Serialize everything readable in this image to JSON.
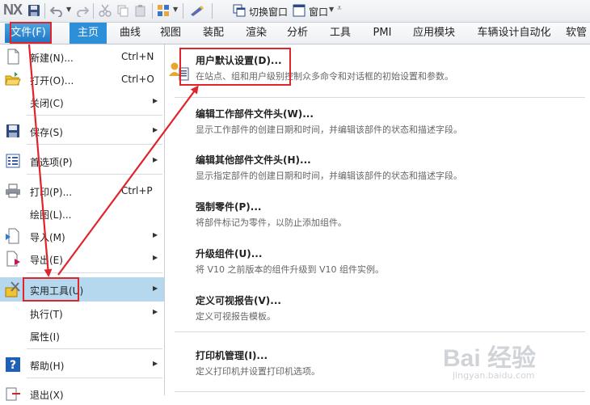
{
  "quick_access": {
    "logo": "NX",
    "switch_window": "切换窗口",
    "window": "窗口"
  },
  "ribbon": {
    "file_tab": "文件(F)",
    "tabs": [
      "主页",
      "曲线",
      "视图",
      "装配",
      "渲染",
      "分析",
      "工具",
      "PMI",
      "应用模块",
      "车辆设计自动化",
      "软管"
    ]
  },
  "file_menu": {
    "items": [
      {
        "label": "新建(N)...",
        "shortcut": "Ctrl+N"
      },
      {
        "label": "打开(O)...",
        "shortcut": "Ctrl+O"
      },
      {
        "label": "关闭(C)"
      },
      {
        "label": "保存(S)"
      },
      {
        "label": "首选项(P)"
      },
      {
        "label": "打印(P)...",
        "shortcut": "Ctrl+P"
      },
      {
        "label": "绘图(L)..."
      },
      {
        "label": "导入(M)"
      },
      {
        "label": "导出(E)"
      },
      {
        "label": "实用工具(U)"
      },
      {
        "label": "执行(T)"
      },
      {
        "label": "属性(I)"
      },
      {
        "label": "帮助(H)"
      },
      {
        "label": "退出(X)"
      }
    ]
  },
  "utilities_panel": {
    "items": [
      {
        "title": "用户默认设置(D)...",
        "desc": "在站点、组和用户级别控制众多命令和对话框的初始设置和参数。"
      },
      {
        "title": "编辑工作部件文件头(W)...",
        "desc": "显示工作部件的创建日期和时间，并编辑该部件的状态和描述字段。"
      },
      {
        "title": "编辑其他部件文件头(H)...",
        "desc": "显示指定部件的创建日期和时间，并编辑该部件的状态和描述字段。"
      },
      {
        "title": "强制零件(P)...",
        "desc": "将部件标记为零件，以防止添加组件。"
      },
      {
        "title": "升级组件(U)...",
        "desc": "将 V10 之前版本的组件升级到 V10 组件实例。"
      },
      {
        "title": "定义可视报告(V)...",
        "desc": "定义可视报告模板。"
      },
      {
        "title": "打印机管理(I)...",
        "desc": "定义打印机并设置打印机选项。"
      }
    ]
  },
  "watermark": {
    "brand": "Bai 经验",
    "url": "jingyan.baidu.com"
  },
  "colors": {
    "annotation_red": "#e0242a",
    "ribbon_blue": "#2d8fd7",
    "selected_menu": "#b6d8ef"
  }
}
